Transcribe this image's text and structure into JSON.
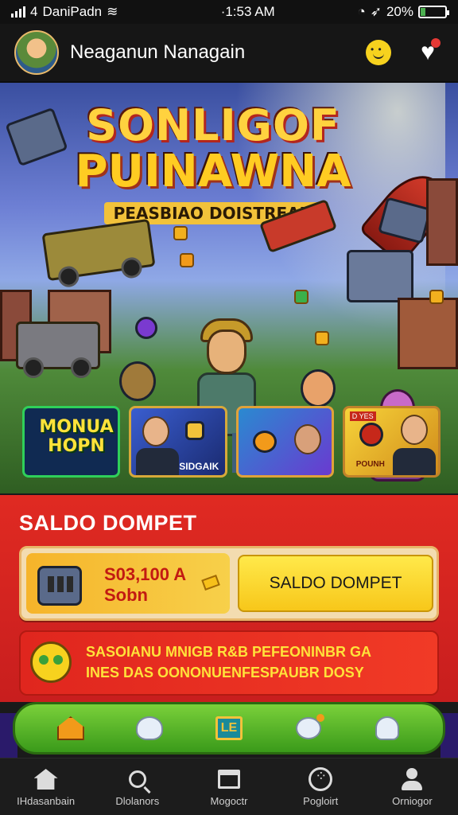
{
  "status_bar": {
    "carrier": "DaniPadn",
    "carrier_prefix": "4",
    "time": "·1:53 AM",
    "battery": "20%",
    "battery_level": 0.2
  },
  "header": {
    "user_name": "Neaganun Nanagain"
  },
  "banner": {
    "title_line1": "SONLIGOF",
    "title_line2": "PUINAWNA",
    "subtitle": "PEASBIAO DOISTREAN",
    "thumbnails": [
      {
        "label": "MONUA HOPN"
      },
      {
        "label": "SIDGAIK"
      },
      {
        "label": ""
      },
      {
        "tag": "D YES",
        "label": "POUNH"
      }
    ]
  },
  "wallet": {
    "title": "SALDO DOMPET",
    "amount_line1": "S03,100 A",
    "amount_line2": "Sobn",
    "button_label": "SALDO DOMPET",
    "promo_line1": "SASOIANU MNIGB R&B PEFEONINBR GA",
    "promo_line2": "INES DAS OONONUENFESPAUBR DOSY",
    "quick_book_label": "LE"
  },
  "tab_bar": {
    "tabs": [
      {
        "label": "IHdasanbain",
        "icon": "home-icon"
      },
      {
        "label": "Dlolanors",
        "icon": "search-icon"
      },
      {
        "label": "Mogoctr",
        "icon": "window-icon"
      },
      {
        "label": "Pogloirt",
        "icon": "gamepad-icon"
      },
      {
        "label": "Orniogor",
        "icon": "user-icon"
      }
    ]
  }
}
